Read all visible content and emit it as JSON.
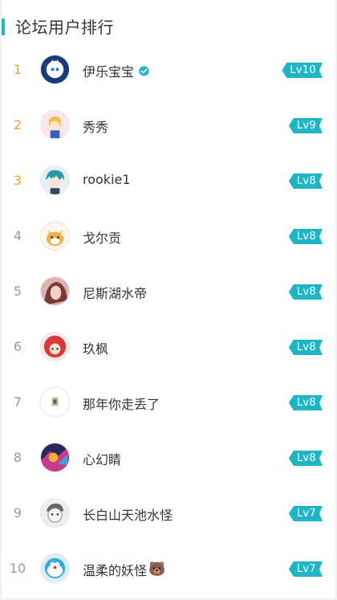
{
  "title": "论坛用户排行",
  "colors": {
    "accent": "#1fb5c7",
    "top_rank": "#f5a030",
    "rank": "#999999"
  },
  "users": [
    {
      "rank": "1",
      "name": "伊乐宝宝",
      "level": "Lv10",
      "verified": true,
      "emoji": ""
    },
    {
      "rank": "2",
      "name": "秀秀",
      "level": "Lv9",
      "verified": false,
      "emoji": ""
    },
    {
      "rank": "3",
      "name": "rookie1",
      "level": "Lv8",
      "verified": false,
      "emoji": ""
    },
    {
      "rank": "4",
      "name": "戈尔贡",
      "level": "Lv8",
      "verified": false,
      "emoji": ""
    },
    {
      "rank": "5",
      "name": "尼斯湖水帝",
      "level": "Lv8",
      "verified": false,
      "emoji": ""
    },
    {
      "rank": "6",
      "name": "玖枫",
      "level": "Lv8",
      "verified": false,
      "emoji": ""
    },
    {
      "rank": "7",
      "name": "那年你走丢了",
      "level": "Lv8",
      "verified": false,
      "emoji": ""
    },
    {
      "rank": "8",
      "name": "心幻睛",
      "level": "Lv8",
      "verified": false,
      "emoji": ""
    },
    {
      "rank": "9",
      "name": "长白山天池水怪",
      "level": "Lv7",
      "verified": false,
      "emoji": ""
    },
    {
      "rank": "10",
      "name": "温柔的妖怪",
      "level": "Lv7",
      "verified": false,
      "emoji": "🐻"
    }
  ]
}
